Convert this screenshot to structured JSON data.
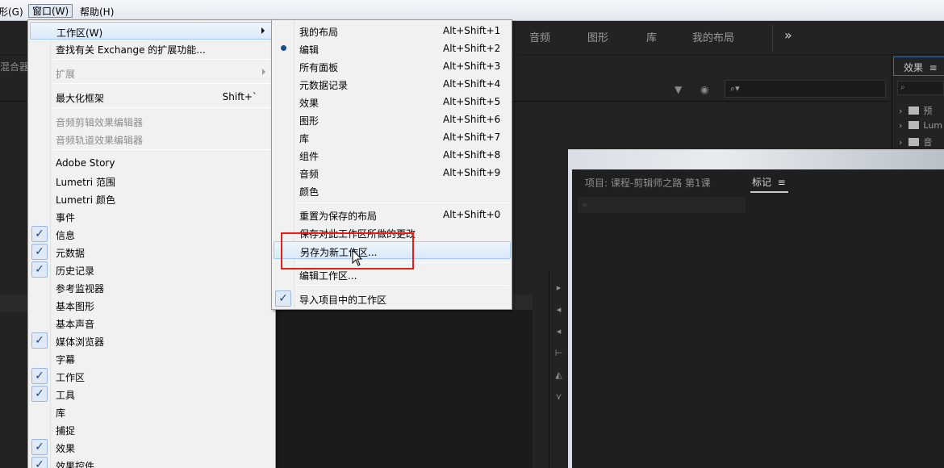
{
  "menubar": {
    "items": [
      "形(G)",
      "窗口(W)",
      "帮助(H)"
    ]
  },
  "workspace_bar": {
    "tabs": [
      "音频",
      "图形",
      "库",
      "我的布局"
    ],
    "more": "»"
  },
  "left_panel_label": "混合器",
  "effects_panel": {
    "tab_label": "效果",
    "menu_icon": "≡",
    "search_icon": "⌕",
    "rows": [
      "预",
      "Lum",
      "音"
    ]
  },
  "source_search_icon": "⌕",
  "project_panel": {
    "title": "项目: 课程-剪辑师之路 第1课",
    "tab_label": "标记",
    "menu_icon": "≡",
    "search_icon": "⌕"
  },
  "window_menu": {
    "items": [
      {
        "label": "工作区(W)",
        "submenu": true,
        "highlighted": true
      },
      {
        "label": "查找有关 Exchange 的扩展功能..."
      },
      {
        "label": "扩展",
        "submenu": true,
        "disabled": true
      },
      {
        "label": "最大化框架",
        "shortcut": "Shift+`"
      },
      {
        "label": "音频剪辑效果编辑器",
        "disabled": true
      },
      {
        "label": "音频轨道效果编辑器",
        "disabled": true
      },
      {
        "label": "Adobe Story"
      },
      {
        "label": "Lumetri 范围"
      },
      {
        "label": "Lumetri 颜色"
      },
      {
        "label": "事件"
      },
      {
        "label": "信息",
        "checked": true
      },
      {
        "label": "元数据",
        "checked": true
      },
      {
        "label": "历史记录",
        "checked": true
      },
      {
        "label": "参考监视器"
      },
      {
        "label": "基本图形"
      },
      {
        "label": "基本声音"
      },
      {
        "label": "媒体浏览器",
        "checked": true
      },
      {
        "label": "字幕"
      },
      {
        "label": "工作区",
        "checked": true
      },
      {
        "label": "工具",
        "checked": true
      },
      {
        "label": "库"
      },
      {
        "label": "捕捉"
      },
      {
        "label": "效果",
        "checked": true
      },
      {
        "label": "效果控件",
        "checked": true
      }
    ],
    "check_glyph": "✓"
  },
  "workspace_submenu": {
    "items": [
      {
        "label": "我的布局",
        "shortcut": "Alt+Shift+1"
      },
      {
        "label": "编辑",
        "shortcut": "Alt+Shift+2",
        "selected": true
      },
      {
        "label": "所有面板",
        "shortcut": "Alt+Shift+3"
      },
      {
        "label": "元数据记录",
        "shortcut": "Alt+Shift+4"
      },
      {
        "label": "效果",
        "shortcut": "Alt+Shift+5"
      },
      {
        "label": "图形",
        "shortcut": "Alt+Shift+6"
      },
      {
        "label": "库",
        "shortcut": "Alt+Shift+7"
      },
      {
        "label": "组件",
        "shortcut": "Alt+Shift+8"
      },
      {
        "label": "音频",
        "shortcut": "Alt+Shift+9"
      },
      {
        "label": "颜色"
      },
      {
        "label": "重置为保存的布局",
        "shortcut": "Alt+Shift+0"
      },
      {
        "label": "保存对此工作区所做的更改"
      },
      {
        "label": "另存为新工作区...",
        "highlighted": true
      },
      {
        "label": "编辑工作区..."
      },
      {
        "label": "导入项目中的工作区",
        "checked": true
      }
    ],
    "check_glyph": "✓"
  }
}
